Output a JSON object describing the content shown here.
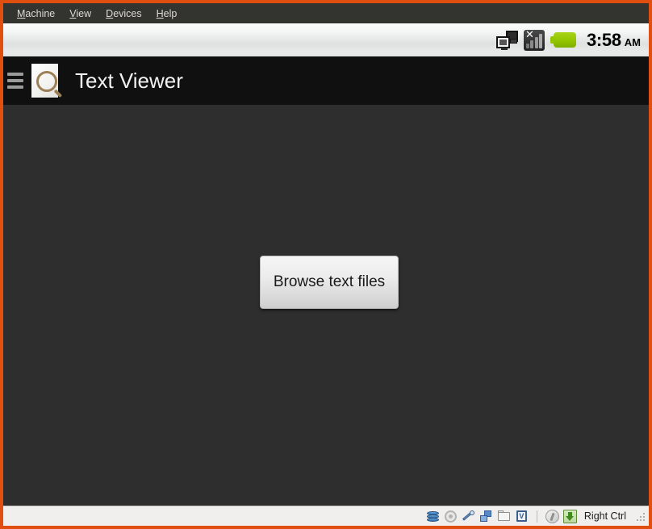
{
  "window": {
    "frame_color": "#e04e10",
    "menu_bar_bg": "#333330"
  },
  "menu": {
    "items": [
      {
        "label": "Machine",
        "mnemonic": "M",
        "rest": "achine"
      },
      {
        "label": "View",
        "mnemonic": "V",
        "rest": "iew"
      },
      {
        "label": "Devices",
        "mnemonic": "D",
        "rest": "evices"
      },
      {
        "label": "Help",
        "mnemonic": "H",
        "rest": "elp"
      }
    ]
  },
  "android": {
    "status_bar": {
      "icons": [
        {
          "name": "adb-connected-icon",
          "title": "USB debugging connected"
        },
        {
          "name": "signal-no-service-icon",
          "title": "No signal"
        },
        {
          "name": "battery-full-icon",
          "title": "Battery full",
          "color": "#93c400"
        }
      ],
      "clock": {
        "time": "3:58",
        "ampm": "AM"
      }
    },
    "action_bar": {
      "menu_icon": "hamburger-icon",
      "app_icon": "text-viewer-app-icon",
      "title": "Text Viewer",
      "bg": "#101010"
    },
    "content": {
      "bg": "#2e2e2e",
      "browse_button_label": "Browse text files"
    }
  },
  "vbox_status": {
    "icons": [
      {
        "name": "hard-disk-icon",
        "title": "Hard Disks"
      },
      {
        "name": "optical-drive-icon",
        "title": "Optical Drives"
      },
      {
        "name": "usb-icon",
        "title": "USB Devices"
      },
      {
        "name": "network-icon",
        "title": "Network Adapters"
      },
      {
        "name": "shared-folders-icon",
        "title": "Shared Folders"
      },
      {
        "name": "video-capture-icon",
        "title": "Video Capture"
      },
      {
        "name": "host-key-icon",
        "title": "Mouse Integration"
      },
      {
        "name": "host-key-state-icon",
        "title": "Host Key"
      }
    ],
    "host_key_label": "Right Ctrl"
  }
}
